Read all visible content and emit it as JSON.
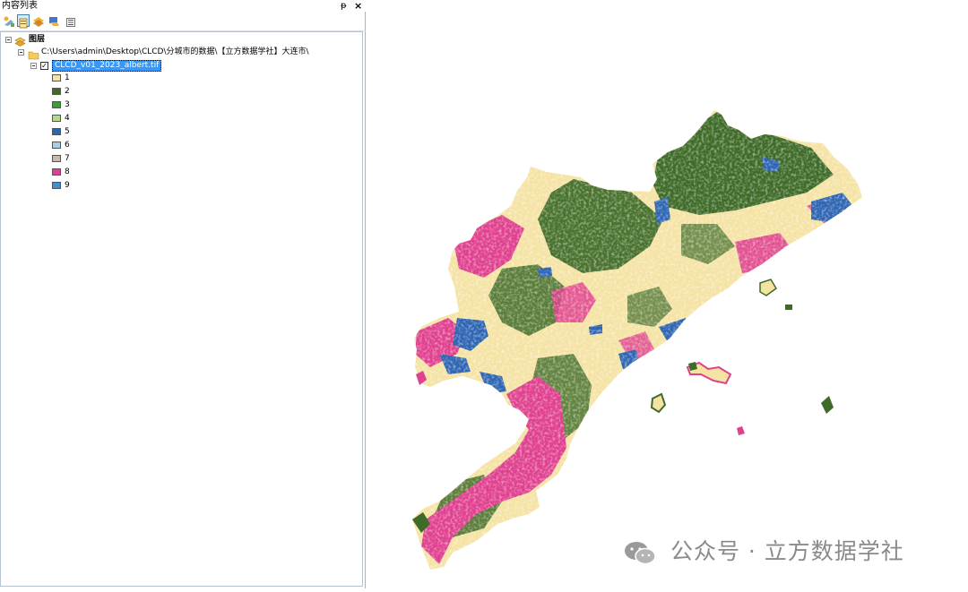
{
  "toc": {
    "title": "内容列表",
    "pin_glyph": "ᵽ",
    "close_glyph": "×",
    "toolbar": [
      "list-by-drawing-order-icon",
      "list-by-source-icon",
      "list-by-visibility-icon",
      "list-by-selection-icon",
      "options-icon"
    ],
    "layers_label": "图层",
    "folder_path": "C:\\Users\\admin\\Desktop\\CLCD\\分城市的数据\\【立方数据学社】大连市\\",
    "layer_name": "CLCD_v01_2023_albert.tif",
    "layer_checked": true,
    "check_glyph": "✓",
    "legend": [
      {
        "label": "1",
        "color": "#f5e3a4"
      },
      {
        "label": "2",
        "color": "#3f6b28"
      },
      {
        "label": "3",
        "color": "#3aa035"
      },
      {
        "label": "4",
        "color": "#b3d98d"
      },
      {
        "label": "5",
        "color": "#2e65b3"
      },
      {
        "label": "6",
        "color": "#a8cde6"
      },
      {
        "label": "7",
        "color": "#c6bba6"
      },
      {
        "label": "8",
        "color": "#e0418f"
      },
      {
        "label": "9",
        "color": "#3d8fd6"
      }
    ]
  },
  "map": {
    "colors": {
      "crop": "#f5e3a4",
      "forest": "#3f6b28",
      "urban": "#e0418f",
      "water": "#2e65b3"
    }
  },
  "watermark": {
    "text": "公众号 · 立方数据学社"
  }
}
